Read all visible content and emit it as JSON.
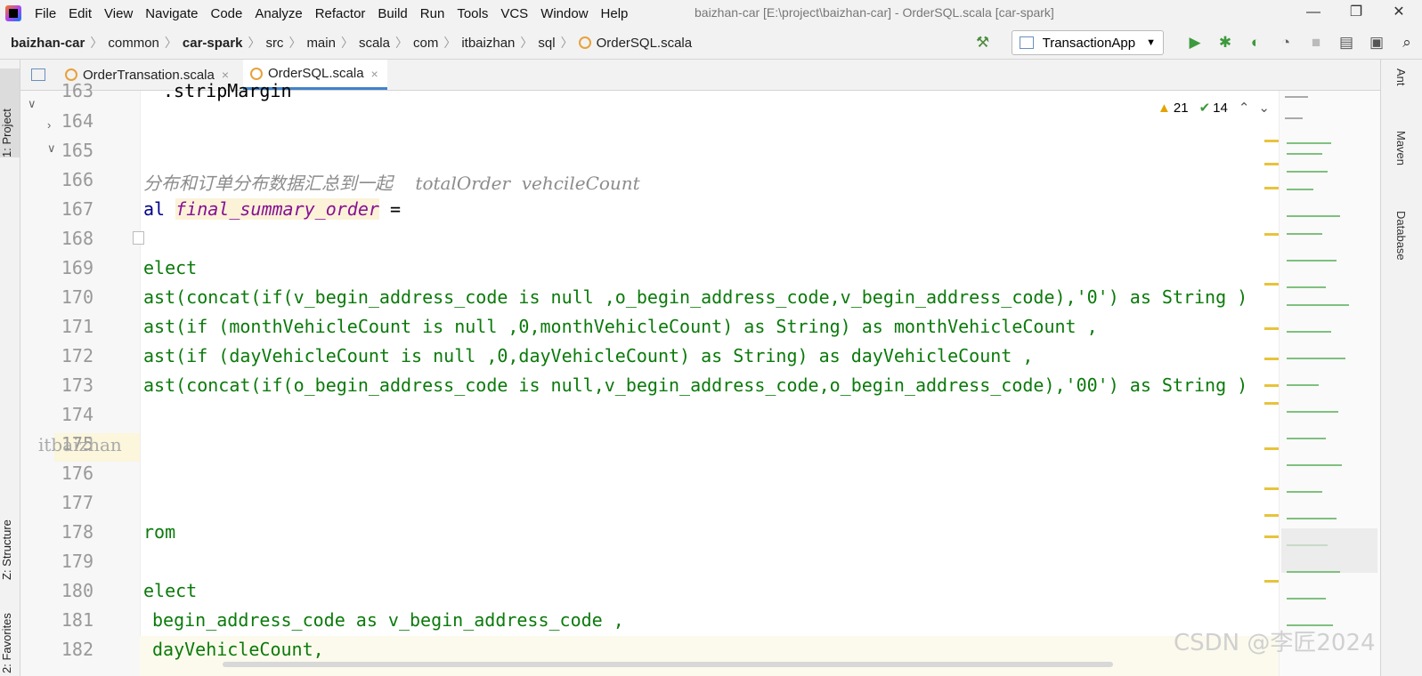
{
  "window": {
    "title": "baizhan-car [E:\\project\\baizhan-car] - OrderSQL.scala [car-spark]",
    "menu": [
      "File",
      "Edit",
      "View",
      "Navigate",
      "Code",
      "Analyze",
      "Refactor",
      "Build",
      "Run",
      "Tools",
      "VCS",
      "Window",
      "Help"
    ],
    "minimize": "—",
    "maximize": "❐",
    "close": "✕"
  },
  "breadcrumb": [
    "baizhan-car",
    "common",
    "car-spark",
    "src",
    "main",
    "scala",
    "com",
    "itbaizhan",
    "sql",
    "OrderSQL.scala"
  ],
  "run_config": {
    "label": "TransactionApp"
  },
  "left_tools": {
    "project": "1: Project",
    "structure": "Z: Structure",
    "favorites": "2: Favorites"
  },
  "right_tools": {
    "ant": "Ant",
    "maven": "Maven",
    "database": "Database"
  },
  "tabs": [
    {
      "label": "OrderTransation.scala",
      "close": "×"
    },
    {
      "label": "OrderSQL.scala",
      "close": "×"
    }
  ],
  "inspections": {
    "warnings": "21",
    "checks": "14"
  },
  "editor": {
    "lines": [
      {
        "no": "163",
        "text": ".stripMargin"
      },
      {
        "no": "164",
        "text": ""
      },
      {
        "no": "165",
        "text": ""
      },
      {
        "no": "166",
        "text": "分布和订单分布数据汇总到一起    totalOrder  vehcileCount"
      },
      {
        "no": "167",
        "kw": "al ",
        "var": "final_summary_order",
        "rest": " ="
      },
      {
        "no": "168",
        "text": ""
      },
      {
        "no": "169",
        "text": "elect"
      },
      {
        "no": "170",
        "text": "ast(concat(if(v_begin_address_code is null ,o_begin_address_code,v_begin_address_code),'0') as String )"
      },
      {
        "no": "171",
        "text": "ast(if (monthVehicleCount is null ,0,monthVehicleCount) as String) as monthVehicleCount ,"
      },
      {
        "no": "172",
        "text": "ast(if (dayVehicleCount is null ,0,dayVehicleCount) as String) as dayVehicleCount ,"
      },
      {
        "no": "173",
        "text": "ast(concat(if(o_begin_address_code is null,v_begin_address_code,o_begin_address_code),'00') as String )"
      },
      {
        "no": "174",
        "text": ""
      },
      {
        "no": "175",
        "text": ""
      },
      {
        "no": "176",
        "text": ""
      },
      {
        "no": "177",
        "text": ""
      },
      {
        "no": "178",
        "text": "rom"
      },
      {
        "no": "179",
        "text": ""
      },
      {
        "no": "180",
        "text": "elect"
      },
      {
        "no": "181",
        "text": "begin_address_code as v_begin_address_code ,"
      },
      {
        "no": "182",
        "text": "dayVehicleCount,"
      }
    ],
    "ghost_text": "itbaizhan"
  },
  "watermark": "CSDN @李匠2024",
  "colors": {
    "accent": "#4083c9",
    "string_green": "#0b7a0b",
    "keyword": "#00008b",
    "var_purple": "#871094"
  }
}
